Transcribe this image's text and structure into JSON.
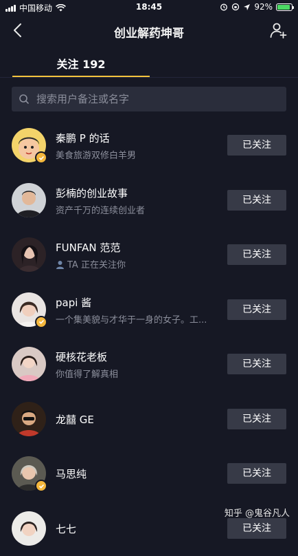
{
  "status_bar": {
    "carrier": "中国移动",
    "time": "18:45",
    "battery": "92%",
    "battery_level": 0.92
  },
  "header": {
    "title": "创业解药坤哥"
  },
  "tabs": [
    {
      "label": "关注 192"
    }
  ],
  "search": {
    "placeholder": "搜索用户备注或名字"
  },
  "follow_label": "已关注",
  "items": [
    {
      "name": "秦鹏 P 的话",
      "bio": "美食旅游双修白羊男",
      "verified": true
    },
    {
      "name": "彭楠的创业故事",
      "bio": "资产千万的连续创业者",
      "verified": false
    },
    {
      "name": "FUNFAN 范范",
      "bio": "TA 正在关注你",
      "verified": false
    },
    {
      "name": "papi 酱",
      "bio": "一个集美貌与才华于一身的女子。工...",
      "verified": true
    },
    {
      "name": "硬核花老板",
      "bio": "你值得了解真相",
      "verified": false
    },
    {
      "name": "龙囍 GE",
      "bio": "",
      "verified": false
    },
    {
      "name": "马思纯",
      "bio": "",
      "verified": true
    },
    {
      "name": "七七",
      "bio": "",
      "verified": false
    }
  ],
  "watermark": "知乎 @鬼谷凡人",
  "colors": {
    "background": "#161824",
    "accent": "#f4c43d",
    "button": "#373a47",
    "verified": "#f4b73c"
  }
}
